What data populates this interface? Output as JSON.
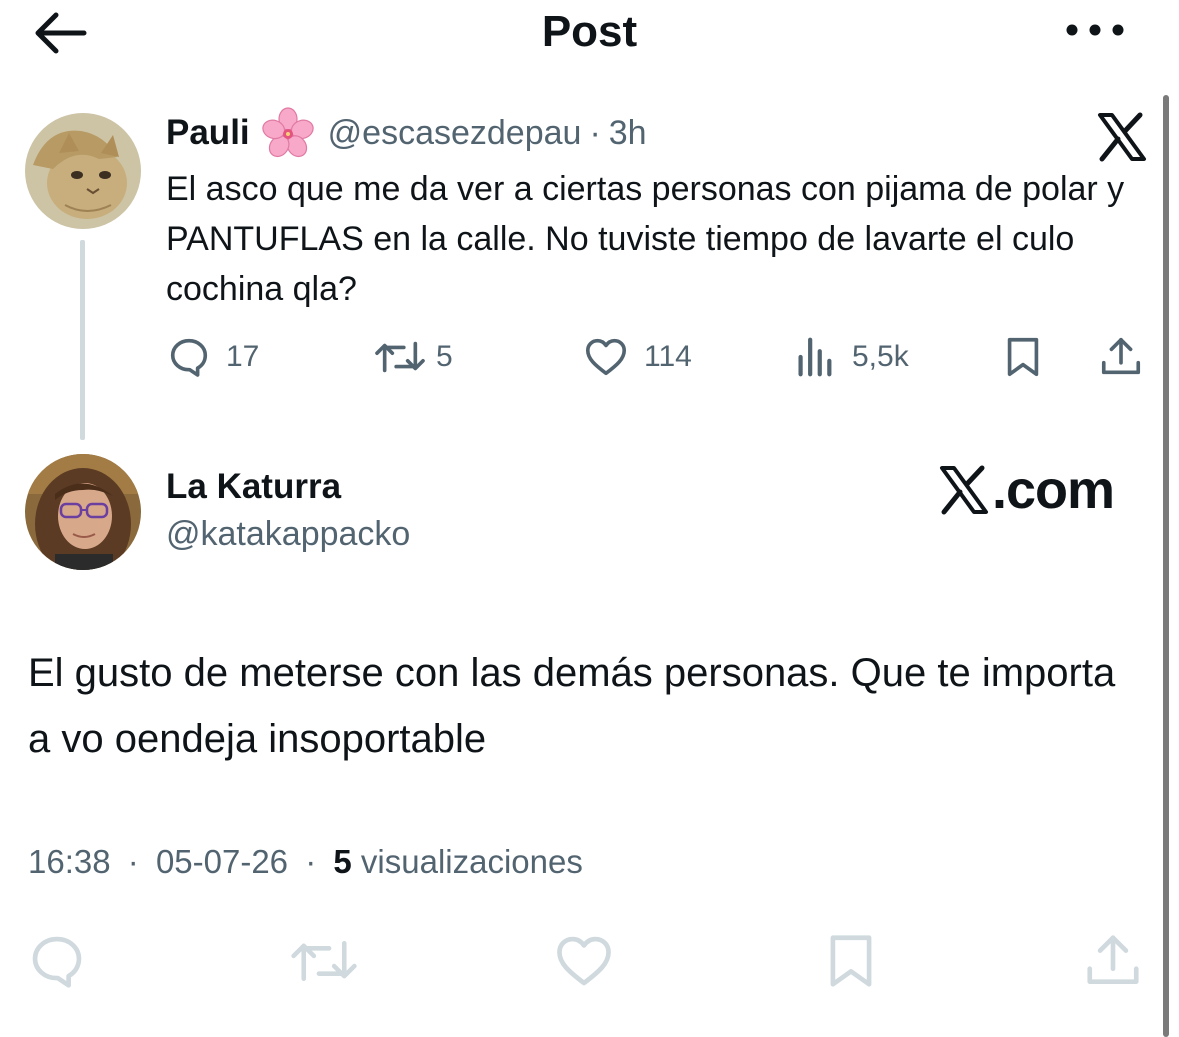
{
  "header": {
    "title": "Post",
    "back_icon": "arrow-left-icon",
    "more_icon": "more-horizontal-icon"
  },
  "parent_tweet": {
    "author_name": "Pauli",
    "author_emoji": "cherry-blossom-icon",
    "handle": "@escasezdepau",
    "separator": "·",
    "time": "3h",
    "text": "El asco que me da ver a ciertas personas con pijama de polar y PANTUFLAS en la calle. No tuviste tiempo de lavarte el culo cochina qla?",
    "actions": {
      "replies": "17",
      "reposts": "5",
      "likes": "114",
      "views": "5,5k"
    }
  },
  "reply_tweet": {
    "author_name": "La Katurra",
    "handle": "@katakappacko",
    "watermark": ".com",
    "text": "El gusto de meterse con las demás personas. Que te importa a vo oendeja insoportable",
    "time": "16:38",
    "date": "05-07-26",
    "separator": "·",
    "views_count": "5",
    "views_label": "visualizaciones"
  },
  "colors": {
    "text": "#0f1419",
    "secondary": "#536471",
    "thread_line": "#cfd9de",
    "faded_icons": "#cfd9de"
  }
}
